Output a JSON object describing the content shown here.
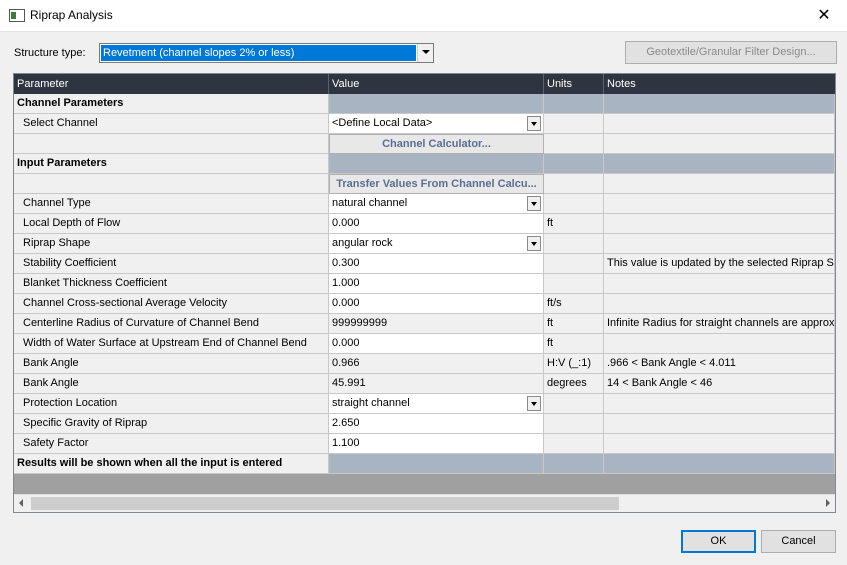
{
  "window": {
    "title": "Riprap Analysis"
  },
  "structure": {
    "label": "Structure type:",
    "value": "Revetment (channel slopes 2% or less)"
  },
  "geo_button": "Geotextile/Granular Filter Design...",
  "columns": [
    "Parameter",
    "Value",
    "Units",
    "Notes"
  ],
  "rows": [
    {
      "type": "section",
      "param": "Channel Parameters"
    },
    {
      "type": "dropdown",
      "param": "Select Channel",
      "value": "<Define Local Data>",
      "units": "",
      "notes": ""
    },
    {
      "type": "button",
      "param": "",
      "value": "Channel Calculator...",
      "units": "",
      "notes": ""
    },
    {
      "type": "section",
      "param": "Input Parameters"
    },
    {
      "type": "button",
      "param": "",
      "value": "Transfer Values From Channel Calcu...",
      "units": "",
      "notes": ""
    },
    {
      "type": "dropdown",
      "param": "Channel Type",
      "value": "natural channel",
      "units": "",
      "notes": ""
    },
    {
      "type": "input",
      "param": "Local Depth of Flow",
      "value": "0.000",
      "units": "ft",
      "notes": ""
    },
    {
      "type": "dropdown",
      "param": "Riprap Shape",
      "value": "angular rock",
      "units": "",
      "notes": ""
    },
    {
      "type": "input",
      "param": "Stability Coefficient",
      "value": "0.300",
      "units": "",
      "notes": "This value is updated by the selected Riprap Sh"
    },
    {
      "type": "input",
      "param": "Blanket Thickness Coefficient",
      "value": "1.000",
      "units": "",
      "notes": ""
    },
    {
      "type": "input",
      "param": "Channel Cross-sectional Average Velocity",
      "value": "0.000",
      "units": "ft/s",
      "notes": ""
    },
    {
      "type": "readonly",
      "param": "Centerline Radius of Curvature of Channel Bend",
      "value": "999999999",
      "units": "ft",
      "notes": "Infinite Radius for straight channels are approx"
    },
    {
      "type": "input",
      "param": "Width of Water Surface at Upstream End of Channel Bend",
      "value": "0.000",
      "units": "ft",
      "notes": ""
    },
    {
      "type": "readonly",
      "param": "Bank Angle",
      "value": "0.966",
      "units": "H:V (_:1)",
      "notes": ".966 < Bank Angle < 4.011"
    },
    {
      "type": "readonly",
      "param": "Bank Angle",
      "value": "45.991",
      "units": "degrees",
      "notes": "14 < Bank Angle < 46"
    },
    {
      "type": "dropdown",
      "param": "Protection Location",
      "value": "straight channel",
      "units": "",
      "notes": ""
    },
    {
      "type": "input",
      "param": "Specific Gravity of Riprap",
      "value": "2.650",
      "units": "",
      "notes": ""
    },
    {
      "type": "input",
      "param": "Safety Factor",
      "value": "1.100",
      "units": "",
      "notes": ""
    },
    {
      "type": "section",
      "param": "Results will be shown when all the input is entered"
    }
  ],
  "buttons": {
    "ok": "OK",
    "cancel": "Cancel"
  }
}
